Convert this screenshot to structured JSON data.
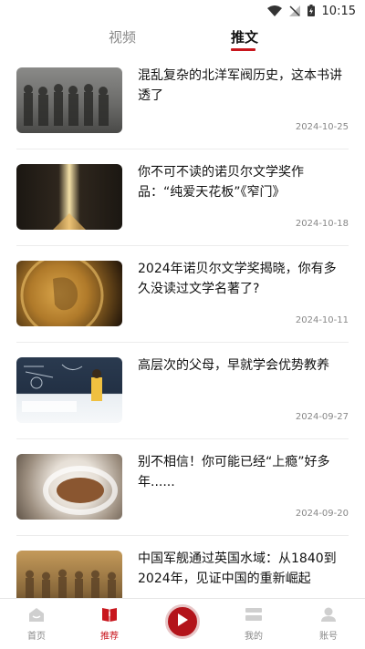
{
  "status": {
    "time": "10:15"
  },
  "tabs": [
    {
      "label": "视频"
    },
    {
      "label": "推文"
    }
  ],
  "articles": [
    {
      "title": "混乱复杂的北洋军阀历史，这本书讲透了",
      "date": "2024-10-25",
      "thumb": "historical-group-photo"
    },
    {
      "title": "你不可不读的诺贝尔文学奖作品：“纯爱天花板”《窄门》",
      "date": "2024-10-18",
      "thumb": "narrow-door-light"
    },
    {
      "title": "2024年诺贝尔文学奖揭晓，你有多久没读过文学名著了?",
      "date": "2024-10-11",
      "thumb": "nobel-medal"
    },
    {
      "title": "高层次的父母，早就学会优势教养",
      "date": "2024-09-27",
      "thumb": "classroom-blackboard"
    },
    {
      "title": "别不相信！你可能已经“上瘾”好多年......",
      "date": "2024-09-20",
      "thumb": "coffee-filter"
    },
    {
      "title": "中国军舰通过英国水域：从1840到2024年，见证中国的重新崛起",
      "date": "",
      "thumb": "terracotta-warriors"
    }
  ],
  "bottom_nav": {
    "home": "首页",
    "recommend": "推荐",
    "mine": "我的",
    "account": "账号"
  },
  "colors": {
    "accent": "#c8161d"
  }
}
